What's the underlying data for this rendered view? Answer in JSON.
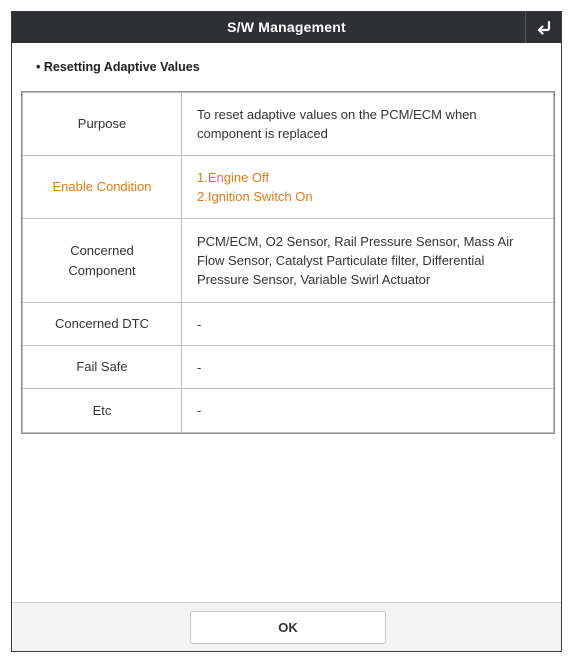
{
  "window": {
    "title": "S/W Management",
    "back_icon": "return-arrow-icon"
  },
  "section": {
    "title": "• Resetting Adaptive Values"
  },
  "table": {
    "rows": [
      {
        "label": "Purpose",
        "value_lines": [
          "To reset adaptive values on the PCM/ECM when",
          "component is replaced"
        ],
        "highlight": false
      },
      {
        "label": "Enable Condition",
        "value_lines": [
          "1.Engine Off",
          "2.Ignition Switch On"
        ],
        "highlight": true
      },
      {
        "label_lines": [
          "Concerned",
          "Component"
        ],
        "value_lines": [
          "PCM/ECM, O2 Sensor, Rail Pressure Sensor, Mass Air",
          "Flow Sensor, Catalyst Particulate filter, Differential",
          "Pressure Sensor, Variable Swirl Actuator"
        ],
        "highlight": false
      },
      {
        "label": "Concerned DTC",
        "value_lines": [
          "-"
        ],
        "highlight": false
      },
      {
        "label": "Fail Safe",
        "value_lines": [
          "-"
        ],
        "highlight": false
      },
      {
        "label": "Etc",
        "value_lines": [
          "-"
        ],
        "highlight": false
      }
    ],
    "highlight_color": "#e07b14"
  },
  "footer": {
    "ok_label": "OK"
  },
  "colors": {
    "titlebar": "#2f3033",
    "accent": "#e07b14"
  }
}
